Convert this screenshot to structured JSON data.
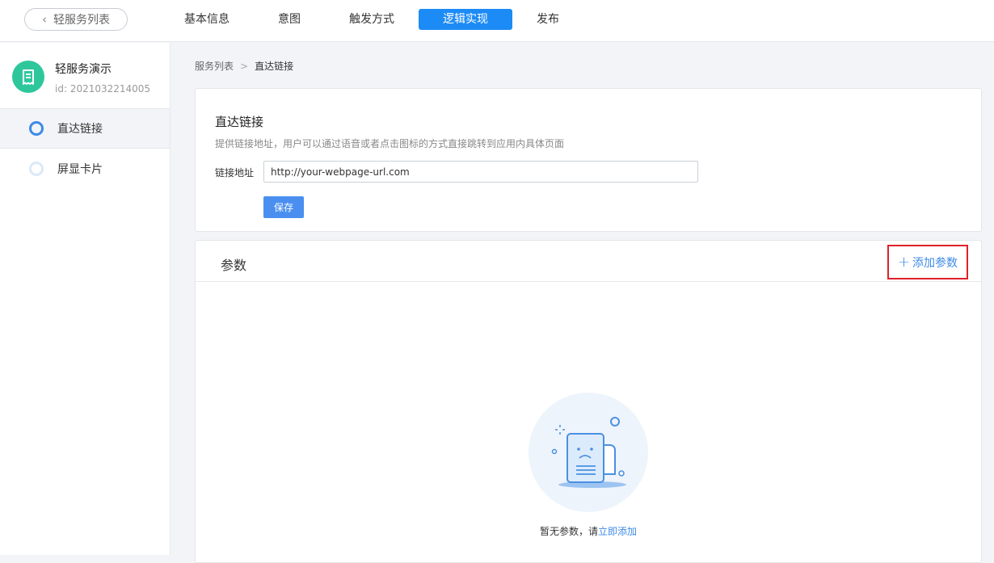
{
  "topbar": {
    "back_label": "轻服务列表",
    "tabs": [
      {
        "label": "基本信息",
        "active": false
      },
      {
        "label": "意图",
        "active": false
      },
      {
        "label": "触发方式",
        "active": false
      },
      {
        "label": "逻辑实现",
        "active": true
      },
      {
        "label": "发布",
        "active": false
      }
    ],
    "accent_color": "#1c8bf6"
  },
  "sidebar": {
    "service_name": "轻服务演示",
    "service_id": "id: 2021032214005",
    "logo_icon": "document-icon",
    "items": [
      {
        "label": "直达链接",
        "active": true
      },
      {
        "label": "屏显卡片",
        "active": false
      }
    ]
  },
  "breadcrumb": {
    "root": "服务列表",
    "separator": ">",
    "current": "直达链接"
  },
  "link_card": {
    "title": "直达链接",
    "description": "提供链接地址，用户可以通过语音或者点击图标的方式直接跳转到应用内具体页面",
    "field_label": "链接地址",
    "url_value": "http://your-webpage-url.com",
    "save_label": "保存"
  },
  "params_card": {
    "title": "参数",
    "add_label": "添加参数",
    "empty_text": "暂无参数，请",
    "empty_link": "立即添加",
    "highlight_color": "#e0202a"
  }
}
